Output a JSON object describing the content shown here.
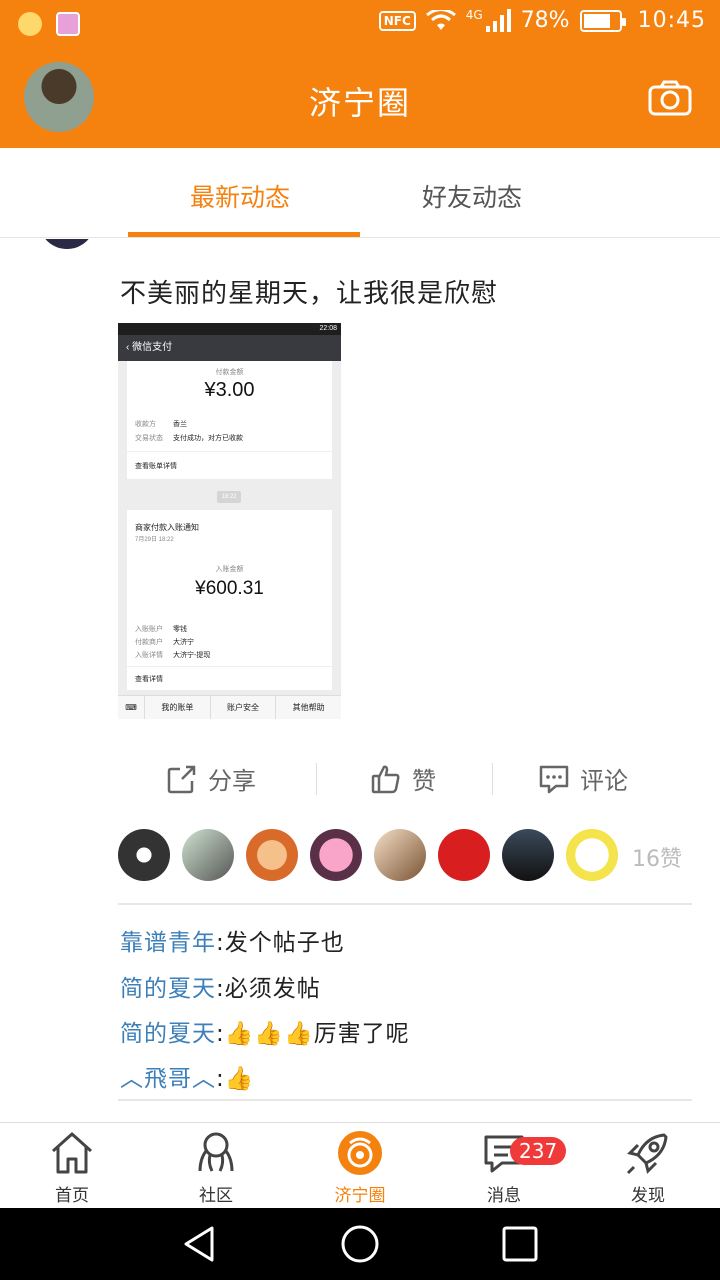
{
  "status_bar": {
    "nfc": "NFC",
    "network": "4G",
    "battery": "78%",
    "battery_level": 0.78,
    "time": "10:45"
  },
  "header": {
    "title": "济宁圈",
    "avatar": "user-avatar",
    "camera": "camera-icon"
  },
  "tabs": [
    {
      "label": "最新动态",
      "active": true
    },
    {
      "label": "好友动态",
      "active": false
    }
  ],
  "post": {
    "text": "不美丽的星期天，让我很是欣慰",
    "image": {
      "header_title": "微信支付",
      "status_time": "22:08",
      "payment": {
        "amount_label": "付款金额",
        "amount": "¥3.00",
        "payee_label": "收款方",
        "payee": "香兰",
        "status_label": "交易状态",
        "status": "支付成功，对方已收款",
        "bill_link": "查看账单详情"
      },
      "time_tag": "18:22",
      "notice": {
        "title": "商家付款入账通知",
        "date": "7月29日 18:22",
        "amount_label": "入账金额",
        "amount": "¥600.31",
        "account_label": "入账账户",
        "account": "零钱",
        "merchant_label": "付款商户",
        "merchant": "大济宁",
        "detail_label": "入账详情",
        "detail": "大济宁-提现",
        "link": "查看详情"
      },
      "footer": [
        "我的账单",
        "账户安全",
        "其他帮助"
      ]
    },
    "actions": {
      "share": "分享",
      "like": "赞",
      "comment": "评论"
    },
    "like_count": "16赞",
    "comments": [
      {
        "user": "靠谱青年",
        "text": ":发个帖子也"
      },
      {
        "user": "简的夏天",
        "text": ":必须发帖"
      },
      {
        "user": "简的夏天",
        "text": ":👍👍👍厉害了呢"
      },
      {
        "user": "︿飛哥︿",
        "text": ":👍"
      }
    ]
  },
  "bottom_nav": [
    {
      "label": "首页",
      "icon": "home-icon"
    },
    {
      "label": "社区",
      "icon": "community-icon"
    },
    {
      "label": "济宁圈",
      "icon": "circle-icon",
      "active": true
    },
    {
      "label": "消息",
      "icon": "message-icon",
      "badge": "237"
    },
    {
      "label": "发现",
      "icon": "rocket-icon"
    }
  ],
  "colors": {
    "accent": "#f5810f",
    "link": "#3d7fb8",
    "badge": "#f03a3a"
  }
}
